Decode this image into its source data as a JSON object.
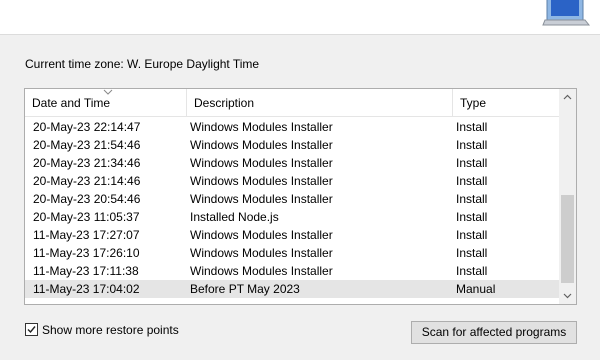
{
  "header_band": {
    "icon": "monitor-icon"
  },
  "timezone": {
    "label": "Current time zone: W. Europe Daylight Time"
  },
  "table": {
    "columns": [
      "Date and Time",
      "Description",
      "Type"
    ],
    "sort_indicator": "chevron-down-icon",
    "rows": [
      {
        "date": "20-May-23 22:14:47",
        "description": "Windows Modules Installer",
        "type": "Install"
      },
      {
        "date": "20-May-23 21:54:46",
        "description": "Windows Modules Installer",
        "type": "Install"
      },
      {
        "date": "20-May-23 21:34:46",
        "description": "Windows Modules Installer",
        "type": "Install"
      },
      {
        "date": "20-May-23 21:14:46",
        "description": "Windows Modules Installer",
        "type": "Install"
      },
      {
        "date": "20-May-23 20:54:46",
        "description": "Windows Modules Installer",
        "type": "Install"
      },
      {
        "date": "20-May-23 11:05:37",
        "description": "Installed Node.js",
        "type": "Install"
      },
      {
        "date": "11-May-23 17:27:07",
        "description": "Windows Modules Installer",
        "type": "Install"
      },
      {
        "date": "11-May-23 17:26:10",
        "description": "Windows Modules Installer",
        "type": "Install"
      },
      {
        "date": "11-May-23 17:11:38",
        "description": "Windows Modules Installer",
        "type": "Install"
      },
      {
        "date": "11-May-23 17:04:02",
        "description": "Before PT May 2023",
        "type": "Manual"
      }
    ],
    "selected_row": 9
  },
  "show_more": {
    "label": "Show more restore points",
    "checked": true
  },
  "scan_button": {
    "label": "Scan for affected programs"
  },
  "colors": {
    "selected_row": "#e5e5e5",
    "window_bg": "#f0f0f0",
    "list_border": "#adadad"
  }
}
